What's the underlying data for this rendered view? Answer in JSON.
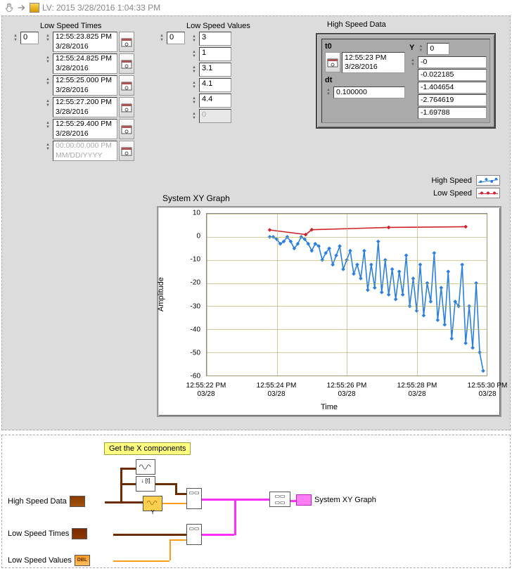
{
  "title": "LV: 2015 3/28/2016 1:04:33 PM",
  "low_speed_times": {
    "label": "Low Speed Times",
    "index": "0",
    "items": [
      {
        "time": "12:55:23.825 PM",
        "date": "3/28/2016",
        "enabled": true
      },
      {
        "time": "12:55:24.825 PM",
        "date": "3/28/2016",
        "enabled": true
      },
      {
        "time": "12:55:25.000 PM",
        "date": "3/28/2016",
        "enabled": true
      },
      {
        "time": "12:55:27.200 PM",
        "date": "3/28/2016",
        "enabled": true
      },
      {
        "time": "12:55:29.400 PM",
        "date": "3/28/2016",
        "enabled": true
      },
      {
        "time": "00:00:00.000 PM",
        "date": "MM/DD/YYYY",
        "enabled": false
      }
    ]
  },
  "low_speed_values": {
    "label": "Low Speed Values",
    "index": "0",
    "items": [
      {
        "v": "3",
        "enabled": true
      },
      {
        "v": "1",
        "enabled": true
      },
      {
        "v": "3.1",
        "enabled": true
      },
      {
        "v": "4.1",
        "enabled": true
      },
      {
        "v": "4.4",
        "enabled": true
      },
      {
        "v": "0",
        "enabled": false
      }
    ]
  },
  "high_speed_data": {
    "label": "High Speed Data",
    "t0_label": "t0",
    "t0_time": "12:55:23 PM",
    "t0_date": "3/28/2016",
    "dt_label": "dt",
    "dt": "0.100000",
    "y_label": "Y",
    "y_index": "0",
    "y": [
      "-0",
      "-0.022185",
      "-1.404654",
      "-2.764619",
      "-1.69788"
    ]
  },
  "legend": {
    "high": "High Speed",
    "low": "Low Speed"
  },
  "graph": {
    "title": "System XY Graph",
    "ylabel": "Amplitude",
    "xlabel": "Time"
  },
  "chart_data": {
    "type": "line",
    "title": "System XY Graph",
    "xlabel": "Time",
    "ylabel": "Amplitude",
    "ylim": [
      -60,
      10
    ],
    "ytick_labels": [
      "10",
      "0",
      "-10",
      "-20",
      "-30",
      "-40",
      "-50",
      "-60"
    ],
    "xtick_labels": [
      "12:55:22 PM\n03/28",
      "12:55:24 PM\n03/28",
      "12:55:26 PM\n03/28",
      "12:55:28 PM\n03/28",
      "12:55:30 PM\n03/28"
    ],
    "x_range_seconds": [
      0,
      8
    ],
    "series": [
      {
        "name": "High Speed",
        "color": "#2a7fe0",
        "x": [
          1.8,
          1.9,
          2.0,
          2.1,
          2.2,
          2.3,
          2.4,
          2.5,
          2.6,
          2.7,
          2.8,
          2.9,
          3.0,
          3.1,
          3.2,
          3.3,
          3.4,
          3.5,
          3.6,
          3.7,
          3.8,
          3.9,
          4.0,
          4.1,
          4.2,
          4.3,
          4.4,
          4.5,
          4.6,
          4.7,
          4.8,
          4.9,
          5.0,
          5.1,
          5.2,
          5.3,
          5.4,
          5.5,
          5.6,
          5.7,
          5.8,
          5.9,
          6.0,
          6.1,
          6.2,
          6.3,
          6.4,
          6.5,
          6.6,
          6.7,
          6.8,
          6.9,
          7.0,
          7.1,
          7.2,
          7.3,
          7.4,
          7.5,
          7.6,
          7.7,
          7.8,
          7.9
        ],
        "values": [
          0,
          0,
          -1,
          -3,
          -2,
          0,
          -2,
          -5,
          -3,
          0,
          -1,
          -3,
          -6,
          -3,
          -4,
          -10,
          -7,
          -5,
          -12,
          -8,
          -4,
          -14,
          -10,
          -6,
          -16,
          -12,
          -18,
          -6,
          -23,
          -12,
          -22,
          -2,
          -24,
          -10,
          -25,
          -14,
          -27,
          -15,
          -25,
          -8,
          -30,
          -18,
          -32,
          -12,
          -34,
          -20,
          -28,
          -7,
          -36,
          -22,
          -38,
          -15,
          -44,
          -28,
          -30,
          -12,
          -46,
          -30,
          -48,
          -20,
          -50,
          -58
        ]
      },
      {
        "name": "Low Speed",
        "color": "#d02328",
        "x": [
          1.8,
          2.825,
          3.0,
          5.2,
          7.4
        ],
        "values": [
          3,
          1,
          3.1,
          4.1,
          4.4
        ]
      }
    ]
  },
  "block_diagram": {
    "comment": "Get the X components",
    "terminals": {
      "high_speed_data": "High Speed Data",
      "low_speed_times": "Low Speed Times",
      "low_speed_values": "Low Speed Values",
      "graph": "System XY Graph"
    }
  }
}
